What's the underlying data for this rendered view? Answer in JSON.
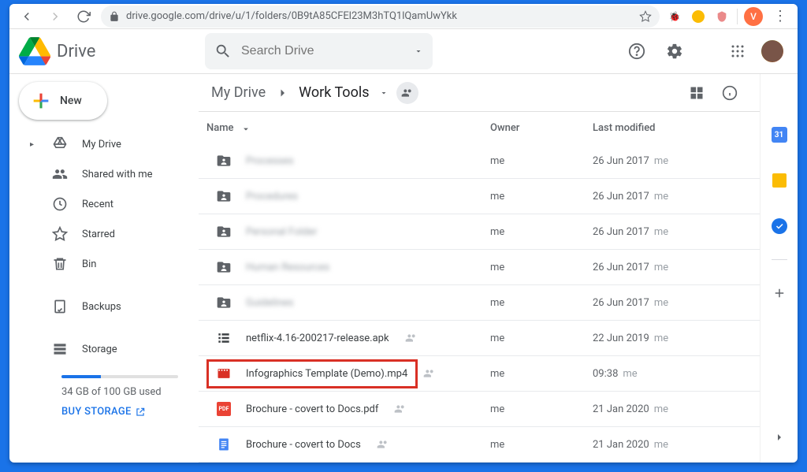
{
  "browser": {
    "url": "drive.google.com/drive/u/1/folders/0B9tA85CFEl23M3hTQ1lQamUwYkk",
    "profile_initial": "V"
  },
  "header": {
    "product": "Drive",
    "search_placeholder": "Search Drive"
  },
  "sidebar": {
    "new_label": "New",
    "items": [
      {
        "label": "My Drive",
        "icon": "my-drive",
        "expandable": true
      },
      {
        "label": "Shared with me",
        "icon": "shared"
      },
      {
        "label": "Recent",
        "icon": "recent"
      },
      {
        "label": "Starred",
        "icon": "starred"
      },
      {
        "label": "Bin",
        "icon": "bin"
      }
    ],
    "backups_label": "Backups",
    "storage_label": "Storage",
    "storage_used": "34 GB of 100 GB used",
    "buy_label": "BUY STORAGE"
  },
  "breadcrumb": {
    "root": "My Drive",
    "current": "Work Tools"
  },
  "columns": {
    "name": "Name",
    "owner": "Owner",
    "modified": "Last modified"
  },
  "rows": [
    {
      "icon": "folder-shared",
      "name": "Processes",
      "blur": true,
      "owner": "me",
      "modified": "26 Jun 2017",
      "by": "me",
      "shared": false
    },
    {
      "icon": "folder-shared",
      "name": "Procedures",
      "blur": true,
      "owner": "me",
      "modified": "26 Jun 2017",
      "by": "me",
      "shared": false
    },
    {
      "icon": "folder-shared",
      "name": "Personal Folder",
      "blur": true,
      "owner": "me",
      "modified": "26 Jun 2017",
      "by": "me",
      "shared": false
    },
    {
      "icon": "folder-shared",
      "name": "Human Resources",
      "blur": true,
      "owner": "me",
      "modified": "26 Jun 2017",
      "by": "me",
      "shared": false
    },
    {
      "icon": "folder-shared",
      "name": "Guidelines",
      "blur": true,
      "owner": "me",
      "modified": "26 Jun 2017",
      "by": "me",
      "shared": false
    },
    {
      "icon": "list",
      "name": "netflix-4.16-200217-release.apk",
      "blur": false,
      "owner": "me",
      "modified": "22 Jun 2019",
      "by": "me",
      "shared": true
    },
    {
      "icon": "video",
      "name": "Infographics Template (Demo).mp4",
      "blur": false,
      "owner": "me",
      "modified": "09:38",
      "by": "me",
      "shared": true,
      "highlight": true
    },
    {
      "icon": "pdf",
      "name": "Brochure - covert to Docs.pdf",
      "blur": false,
      "owner": "me",
      "modified": "21 Jan 2020",
      "by": "me",
      "shared": true
    },
    {
      "icon": "docs",
      "name": "Brochure - covert to Docs",
      "blur": false,
      "owner": "me",
      "modified": "21 Jan 2020",
      "by": "me",
      "shared": true
    }
  ]
}
